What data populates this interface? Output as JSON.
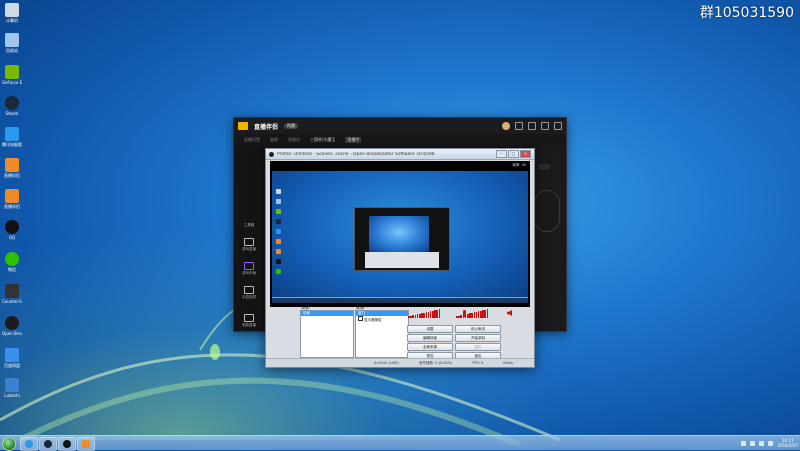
{
  "watermark": "群105031590",
  "desktop_icons": [
    {
      "label": "计算机",
      "icon": "computer-icon",
      "color": "#cfd9e6"
    },
    {
      "label": "回收站",
      "icon": "recycle-bin-icon",
      "color": "#9fc7ec"
    },
    {
      "label": "GeForce Experience",
      "icon": "nvidia-icon",
      "color": "#76b900"
    },
    {
      "label": "Steam",
      "icon": "steam-icon",
      "color": "#1b2838"
    },
    {
      "label": "腾讯电脑管家",
      "icon": "shield-icon",
      "color": "#2a9af0"
    },
    {
      "label": "直播伴侣",
      "icon": "live-app-icon",
      "color": "#f08a24"
    },
    {
      "label": "直播伴侣",
      "icon": "live-app-icon",
      "color": "#f08a24"
    },
    {
      "label": "QQ",
      "icon": "qq-icon",
      "color": "#111111"
    },
    {
      "label": "微信",
      "icon": "wechat-icon",
      "color": "#2dc100"
    },
    {
      "label": "Counter-Strike",
      "icon": "game-icon",
      "color": "#333333"
    },
    {
      "label": "Open Broadcaster",
      "icon": "obs-icon",
      "color": "#1a1a1a"
    },
    {
      "label": "百度网盘",
      "icon": "cloud-icon",
      "color": "#3b8ff0"
    },
    {
      "label": "Ludashi",
      "icon": "app-icon",
      "color": "#3a80d0"
    }
  ],
  "live_app": {
    "title": "直播伴侣",
    "badge": "内测",
    "tabs": [
      "直播设置",
      "美颜",
      "直播间",
      "三国杀/大魔王"
    ],
    "live_tag": "直播中",
    "side_items": [
      "工具箱",
      "游戏直播",
      "游戏手柄",
      "手游投屏",
      "电脑直播"
    ]
  },
  "obs": {
    "title": "Profile: Untitled - Scenes: scene - Open Broadcaster Software v0.659b",
    "fps": "帧率: 30",
    "scenes_header": "场景:",
    "sources_header": "来源:",
    "scenes": [
      "场景"
    ],
    "sources": [
      "窗口",
      "显示器捕捉"
    ],
    "buttons": {
      "settings": "设置",
      "stop_preview": "停止串流",
      "edit_scene": "编辑场景",
      "start_recording": "开始录制",
      "global_sources": "全局来源",
      "plugins": "插件",
      "preview": "预览",
      "exit": "退出"
    },
    "status": {
      "time": "0:00:00 (LIVE)",
      "dropped": "丢失帧数: 0 (0.00%)",
      "fps": "FPS: 0",
      "kbps": "0kb/s"
    }
  },
  "clock": {
    "time": "10:17",
    "date": "2018/3/27"
  }
}
